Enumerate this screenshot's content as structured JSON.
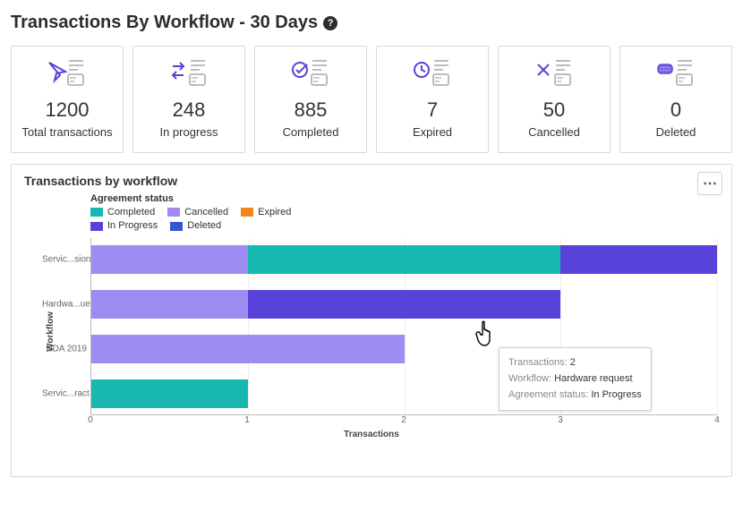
{
  "title": "Transactions By Workflow - 30 Days",
  "metrics": [
    {
      "value": "1200",
      "label": "Total transactions"
    },
    {
      "value": "248",
      "label": "In progress"
    },
    {
      "value": "885",
      "label": "Completed"
    },
    {
      "value": "7",
      "label": "Expired"
    },
    {
      "value": "50",
      "label": "Cancelled"
    },
    {
      "value": "0",
      "label": "Deleted"
    }
  ],
  "panel": {
    "title": "Transactions by workflow",
    "legend_title": "Agreement status",
    "legend": {
      "row1": {
        "a": "Completed",
        "b": "Cancelled",
        "c": "Expired"
      },
      "row2": {
        "a": "In Progress",
        "b": "Deleted"
      }
    }
  },
  "colors": {
    "completed": "#18b8b0",
    "cancelled": "#9f8cf2",
    "expired": "#f0891b",
    "inprogress": "#5743d9",
    "deleted": "#3555d1"
  },
  "chart_data": {
    "type": "bar",
    "orientation": "horizontal",
    "stacked": true,
    "xlabel": "Transactions",
    "ylabel": "Workflow",
    "xlim": [
      0,
      4
    ],
    "x_ticks": [
      "0",
      "1",
      "2",
      "3",
      "4"
    ],
    "categories": [
      "Servic...sion",
      "Hardwa...uest",
      "NDA 2019",
      "Servic...ract"
    ],
    "series": [
      {
        "name": "Cancelled",
        "color_key": "cancelled",
        "values": [
          1,
          1,
          2,
          0
        ]
      },
      {
        "name": "Completed",
        "color_key": "completed",
        "values": [
          2,
          0,
          0,
          1
        ]
      },
      {
        "name": "In Progress",
        "color_key": "inprogress",
        "values": [
          1,
          2,
          0,
          0
        ]
      }
    ]
  },
  "tooltip": {
    "k1": "Transactions:",
    "v1": "2",
    "k2": "Workflow:",
    "v2": "Hardware request",
    "k3": "Agreement status:",
    "v3": "In Progress"
  }
}
